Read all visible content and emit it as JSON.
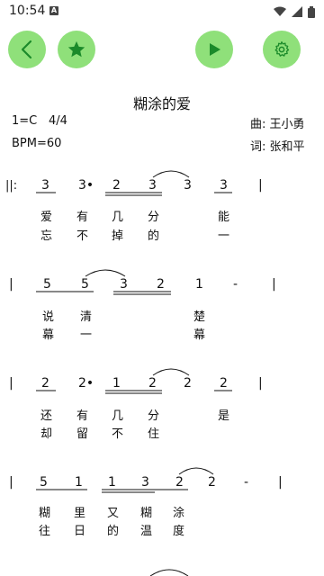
{
  "status": {
    "time": "10:54",
    "notif_badge": "A"
  },
  "toolbar": {
    "back": "chevron-left-icon",
    "favorite": "star-icon",
    "play": "play-icon",
    "settings": "gear-icon",
    "accent": "#8fe07a",
    "icon_color": "#1b8a2a"
  },
  "song": {
    "title": "糊涂的爱",
    "key": "1=C",
    "meter": "4/4",
    "bpm": "BPM=60",
    "composer": "曲: 王小勇",
    "lyricist": "词: 张和平"
  },
  "rows": [
    {
      "start": "||:",
      "notes": [
        "3",
        "3•",
        "2",
        "3",
        "3",
        "3"
      ],
      "bar": "|",
      "lyrics1": [
        "爱",
        "有",
        "几",
        "分",
        "能"
      ],
      "lyrics2": [
        "忘",
        "不",
        "掉",
        "的",
        "一"
      ]
    },
    {
      "start": "|",
      "notes": [
        "5",
        "5",
        "3",
        "2",
        "1",
        "-"
      ],
      "bar": "|",
      "lyrics1": [
        "说",
        "清",
        "楚"
      ],
      "lyrics2": [
        "幕",
        "一",
        "幕"
      ]
    },
    {
      "start": "|",
      "notes": [
        "2",
        "2•",
        "1",
        "2",
        "2",
        "2"
      ],
      "bar": "|",
      "lyrics1": [
        "还",
        "有",
        "几",
        "分",
        "是"
      ],
      "lyrics2": [
        "却",
        "留",
        "不",
        "住"
      ]
    },
    {
      "start": "|",
      "notes": [
        "5",
        "1",
        "1",
        "3",
        "2",
        "2",
        "-"
      ],
      "bar": "|",
      "lyrics1": [
        "糊",
        "里",
        "又",
        "糊",
        "涂"
      ],
      "lyrics2": [
        "往",
        "日",
        "的",
        "温",
        "度"
      ]
    }
  ]
}
